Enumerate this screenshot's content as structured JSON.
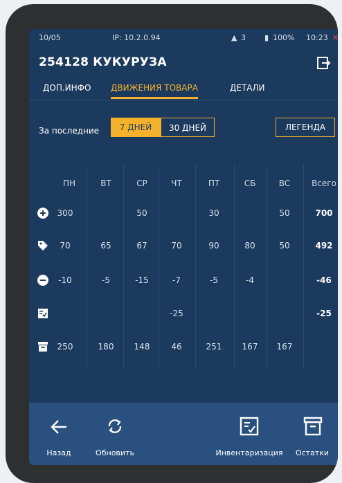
{
  "status": {
    "date": "10/05",
    "ip": "IP: 10.2.0.94",
    "users": "3",
    "battery": "100%",
    "time": "10:23"
  },
  "header": {
    "title": "254128 КУКУРУЗА"
  },
  "tabs": [
    {
      "label": "ДОП.ИНФО",
      "active": false
    },
    {
      "label": "ДВИЖЕНИЯ ТОВАРА",
      "active": true
    },
    {
      "label": "ДЕТАЛИ",
      "active": false
    }
  ],
  "period": {
    "label": "За последние",
    "options": [
      "7 ДНЕЙ",
      "30 ДНЕЙ"
    ],
    "selected": "7 ДНЕЙ",
    "legend": "ЛЕГЕНДА"
  },
  "table": {
    "columns": [
      "ПН",
      "ВТ",
      "СР",
      "ЧТ",
      "ПТ",
      "СБ",
      "ВС",
      "Всего"
    ],
    "rows": [
      {
        "icon": "plus-circle-icon",
        "values": [
          "300",
          "",
          "50",
          "",
          "30",
          "",
          "50"
        ],
        "total": "700"
      },
      {
        "icon": "tag-icon",
        "values": [
          "70",
          "65",
          "67",
          "70",
          "90",
          "80",
          "50"
        ],
        "total": "492"
      },
      {
        "icon": "minus-circle-icon",
        "values": [
          "-10",
          "-5",
          "-15",
          "-7",
          "-5",
          "-4",
          ""
        ],
        "total": "-46"
      },
      {
        "icon": "inventory-check-icon",
        "values": [
          "",
          "",
          "",
          "-25",
          "",
          "",
          ""
        ],
        "total": "-25"
      },
      {
        "icon": "archive-box-icon",
        "values": [
          "250",
          "180",
          "148",
          "46",
          "251",
          "167",
          "167"
        ],
        "total": ""
      }
    ]
  },
  "bottom": {
    "back": "Назад",
    "refresh": "Обновить",
    "inventory": "Инвентаризация",
    "stock": "Остатки"
  },
  "colors": {
    "background": "#1c3a5e",
    "accent": "#f4b22c",
    "bottom_bar": "#2a5080"
  }
}
